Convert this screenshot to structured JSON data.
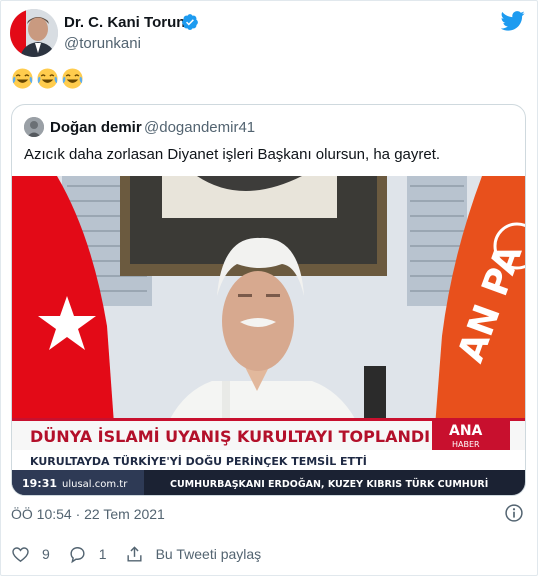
{
  "author": {
    "name": "Dr. C. Kani Torun",
    "handle": "@torunkani"
  },
  "tweet_text_emojis": [
    "face-with-tears-of-joy",
    "face-with-tears-of-joy",
    "face-with-tears-of-joy"
  ],
  "quoted": {
    "name": "Doğan demir",
    "handle": "@dogandemir41",
    "text": "Azıcık daha zorlasan Diyanet işleri Başkanı olursun, ha gayret.",
    "image": {
      "headline": "DÜNYA İSLAMİ UYANIŞ KURULTAYI TOPLANDI",
      "subline": "KURULTAYDA TÜRKİYE'Yİ DOĞU PERİNÇEK TEMSİL ETTİ",
      "channel_line1": "ANA",
      "channel_line2": "HABER",
      "time": "19:31",
      "site": "ulusal.com.tr",
      "ticker": "CUMHURBAŞKANI ERDOĞAN, KUZEY KIBRIS TÜRK CUMHURİ",
      "flag_text": "AN PA"
    }
  },
  "timestamp": "ÖÖ 10:54 · 22 Tem 2021",
  "actions": {
    "likes": "9",
    "replies": "1",
    "share_label": "Bu Tweeti paylaş"
  },
  "colors": {
    "twitter_blue": "#1d9bf0",
    "verified_blue": "#1d9bf0",
    "flag_red": "#e30a17",
    "party_orange": "#e8501c"
  }
}
